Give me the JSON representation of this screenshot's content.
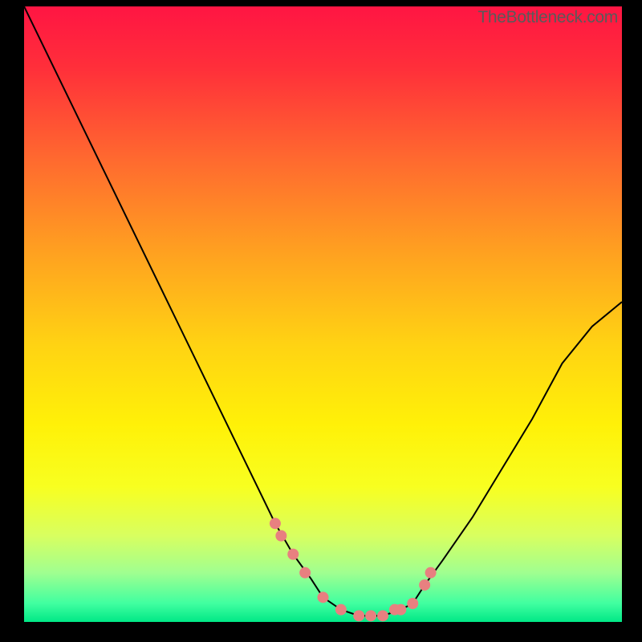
{
  "watermark": "TheBottleneck.com",
  "chart_data": {
    "type": "line",
    "title": "",
    "xlabel": "",
    "ylabel": "",
    "xlim": [
      0,
      100
    ],
    "ylim": [
      0,
      100
    ],
    "series": [
      {
        "name": "curve",
        "x": [
          0,
          5,
          10,
          15,
          20,
          25,
          30,
          35,
          40,
          42,
          45,
          48,
          50,
          53,
          56,
          58,
          60,
          63,
          65,
          67,
          70,
          75,
          80,
          85,
          90,
          95,
          100
        ],
        "y": [
          100,
          90,
          80,
          70,
          60,
          50,
          40,
          30,
          20,
          16,
          11,
          7,
          4,
          2,
          1,
          1,
          1,
          2,
          3,
          6,
          10,
          17,
          25,
          33,
          42,
          48,
          52
        ]
      }
    ],
    "markers": {
      "name": "highlight-dots",
      "color": "#e88080",
      "x": [
        42,
        43,
        45,
        47,
        50,
        53,
        56,
        58,
        60,
        62,
        63,
        65,
        67,
        68
      ],
      "y": [
        16,
        14,
        11,
        8,
        4,
        2,
        1,
        1,
        1,
        2,
        2,
        3,
        6,
        8
      ]
    },
    "gradient_stops": [
      {
        "offset": 0.0,
        "color": "#ff1543"
      },
      {
        "offset": 0.1,
        "color": "#ff2f3a"
      },
      {
        "offset": 0.25,
        "color": "#ff6a2f"
      },
      {
        "offset": 0.4,
        "color": "#ffa120"
      },
      {
        "offset": 0.55,
        "color": "#ffd313"
      },
      {
        "offset": 0.68,
        "color": "#fff108"
      },
      {
        "offset": 0.78,
        "color": "#f8ff20"
      },
      {
        "offset": 0.86,
        "color": "#d8ff60"
      },
      {
        "offset": 0.92,
        "color": "#a0ff90"
      },
      {
        "offset": 0.97,
        "color": "#40ffa0"
      },
      {
        "offset": 1.0,
        "color": "#00e886"
      }
    ]
  }
}
